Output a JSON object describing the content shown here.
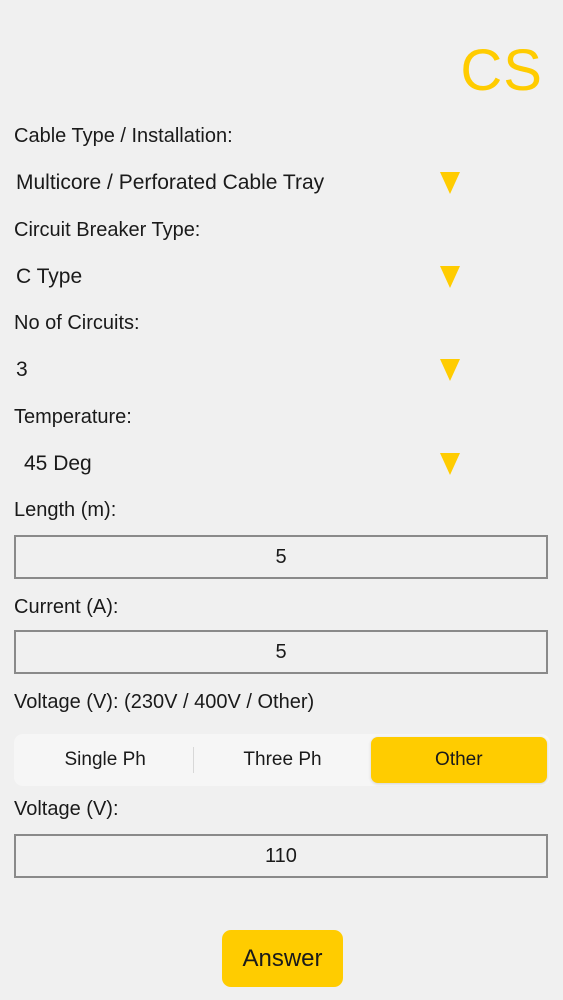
{
  "header": {
    "logo": "CS"
  },
  "cable_type": {
    "label": "Cable Type / Installation:",
    "value": "Multicore / Perforated Cable Tray"
  },
  "breaker_type": {
    "label": "Circuit Breaker Type:",
    "value": "C Type"
  },
  "circuits": {
    "label": "No of Circuits:",
    "value": "3"
  },
  "temperature": {
    "label": "Temperature:",
    "value": "45 Deg"
  },
  "length": {
    "label": "Length (m):",
    "value": "5"
  },
  "current": {
    "label": "Current (A):",
    "value": "5"
  },
  "voltage_select": {
    "label": "Voltage (V): (230V / 400V / Other)",
    "options": [
      "Single Ph",
      "Three Ph",
      "Other"
    ],
    "selected": "Other"
  },
  "voltage": {
    "label": "Voltage (V):",
    "value": "110"
  },
  "answer_button": {
    "label": "Answer"
  },
  "colors": {
    "accent": "#ffcc00",
    "background": "#f0f0f0",
    "field_border": "#8a8a8a"
  }
}
